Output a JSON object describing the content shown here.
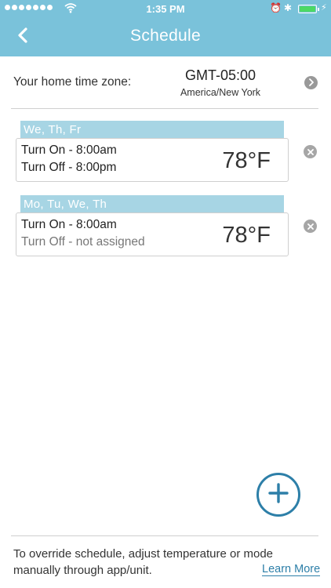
{
  "status_bar": {
    "time": "1:35 PM",
    "icons": [
      "cellular-signal-icon",
      "wifi-icon",
      "alarm-icon",
      "bluetooth-icon",
      "battery-icon",
      "charging-bolt-icon"
    ],
    "battery_level": 1.0
  },
  "header": {
    "title": "Schedule",
    "back_icon": "chevron-left-icon"
  },
  "timezone": {
    "label": "Your home time zone:",
    "offset": "GMT-05:00",
    "name": "America/New York",
    "chevron_icon": "chevron-right-icon"
  },
  "schedules": [
    {
      "days": "We, Th, Fr",
      "turn_on": "Turn On - 8:00am",
      "turn_off": "Turn Off - 8:00pm",
      "temperature": "78°F"
    },
    {
      "days": "Mo, Tu, We, Th",
      "turn_on": "Turn On - 8:00am",
      "turn_off": "Turn Off - not assigned",
      "temperature": "78°F"
    }
  ],
  "add_button_icon": "plus-icon",
  "footer": {
    "text": "To override schedule, adjust temperature or mode manually through app/unit.",
    "link": "Learn More"
  },
  "colors": {
    "header": "#7ac2da",
    "days_tab": "#a7d5e4",
    "accent": "#2d7fa8",
    "battery": "#4cd964"
  }
}
